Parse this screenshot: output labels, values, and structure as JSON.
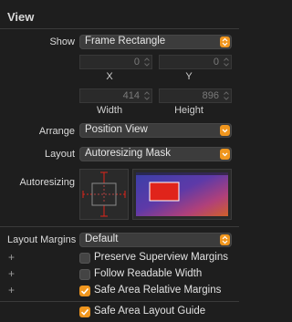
{
  "section": {
    "title": "View"
  },
  "show": {
    "label": "Show",
    "value": "Frame Rectangle"
  },
  "origin": {
    "x": "0",
    "y": "0",
    "x_label": "X",
    "y_label": "Y"
  },
  "size": {
    "width": "414",
    "height": "896",
    "width_label": "Width",
    "height_label": "Height"
  },
  "arrange": {
    "label": "Arrange",
    "value": "Position View"
  },
  "layout": {
    "label": "Layout",
    "value": "Autoresizing Mask"
  },
  "autoresizing": {
    "label": "Autoresizing"
  },
  "layout_margins": {
    "label": "Layout Margins",
    "value": "Default"
  },
  "margin_options": [
    {
      "label": "Preserve Superview Margins",
      "checked": false
    },
    {
      "label": "Follow Readable Width",
      "checked": false
    },
    {
      "label": "Safe Area Relative Margins",
      "checked": true
    },
    {
      "label": "Safe Area Layout Guide",
      "checked": true
    }
  ],
  "plus_symbol": "+",
  "colors": {
    "accent": "#f0961e",
    "background": "#1e1e1e",
    "autoresizing_red": "#e0241b"
  }
}
